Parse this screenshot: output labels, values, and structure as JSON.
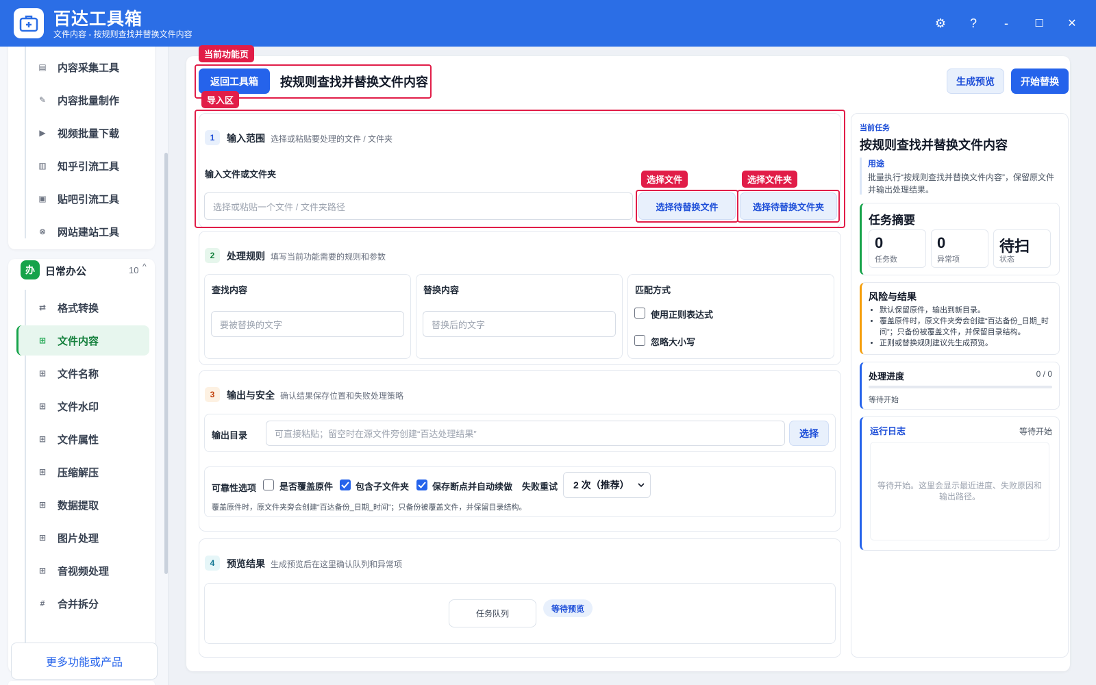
{
  "app": {
    "title": "百达工具箱",
    "subtitle": "文件内容 - 按规则查找并替换文件内容"
  },
  "window": {
    "settings": "⚙",
    "help": "?",
    "minimize": "-",
    "maximize": "☐",
    "close": "✕"
  },
  "sidebar": {
    "top_items": [
      {
        "label": "内容采集工具",
        "icon": "clipboard-icon",
        "glyph": "▤"
      },
      {
        "label": "内容批量制作",
        "icon": "pencil-icon",
        "glyph": "✎"
      },
      {
        "label": "视频批量下载",
        "icon": "video-icon",
        "glyph": "▶"
      },
      {
        "label": "知乎引流工具",
        "icon": "book-icon",
        "glyph": "▥"
      },
      {
        "label": "贴吧引流工具",
        "icon": "message-icon",
        "glyph": "▣"
      },
      {
        "label": "网站建站工具",
        "icon": "globe-icon",
        "glyph": "⊗"
      }
    ],
    "group": {
      "badge": "办",
      "title": "日常办公",
      "count": "10",
      "caret": "^"
    },
    "group_items": [
      {
        "label": "格式转换",
        "icon": "swap-icon",
        "glyph": "⇄"
      },
      {
        "label": "文件内容",
        "icon": "grid-icon",
        "glyph": "⊞"
      },
      {
        "label": "文件名称",
        "icon": "grid-icon",
        "glyph": "⊞"
      },
      {
        "label": "文件水印",
        "icon": "grid-icon",
        "glyph": "⊞"
      },
      {
        "label": "文件属性",
        "icon": "grid-icon",
        "glyph": "⊞"
      },
      {
        "label": "压缩解压",
        "icon": "grid-icon",
        "glyph": "⊞"
      },
      {
        "label": "数据提取",
        "icon": "grid-icon",
        "glyph": "⊞"
      },
      {
        "label": "图片处理",
        "icon": "grid-icon",
        "glyph": "⊞"
      },
      {
        "label": "音视频处理",
        "icon": "grid-icon",
        "glyph": "⊞"
      },
      {
        "label": "合并拆分",
        "icon": "hash-icon",
        "glyph": "#"
      }
    ],
    "more": "更多功能或产品"
  },
  "header": {
    "tag": "当前功能页",
    "back": "返回工具箱",
    "title": "按规则查找并替换文件内容",
    "preview": "生成预览",
    "start": "开始替换"
  },
  "import_tag": "导入区",
  "section1": {
    "num": "1",
    "title": "输入范围",
    "desc": "选择或粘贴要处理的文件 / 文件夹",
    "field_label": "输入文件或文件夹",
    "placeholder": "选择或粘贴一个文件 / 文件夹路径",
    "file_tag": "选择文件",
    "folder_tag": "选择文件夹",
    "file_btn": "选择待替换文件",
    "folder_btn": "选择待替换文件夹"
  },
  "section2": {
    "num": "2",
    "title": "处理规则",
    "desc": "填写当前功能需要的规则和参数",
    "find_label": "查找内容",
    "find_placeholder": "要被替换的文字",
    "replace_label": "替换内容",
    "replace_placeholder": "替换后的文字",
    "match_label": "匹配方式",
    "regex": "使用正则表达式",
    "ignore_case": "忽略大小写"
  },
  "section3": {
    "num": "3",
    "title": "输出与安全",
    "desc": "确认结果保存位置和失败处理策略",
    "out_label": "输出目录",
    "out_placeholder": "可直接粘贴；留空时在源文件旁创建“百达处理结果”",
    "choose": "选择",
    "rel_label": "可靠性选项",
    "overwrite": "是否覆盖原件",
    "subfolder": "包含子文件夹",
    "resume": "保存断点并自动续做",
    "retry_label": "失败重试",
    "retry_value": "2 次（推荐）",
    "note": "覆盖原件时，原文件夹旁会创建“百达备份_日期_时间”；只备份被覆盖文件，并保留目录结构。"
  },
  "section4": {
    "num": "4",
    "title": "预览结果",
    "desc": "生成预览后在这里确认队列和异常项",
    "queue": "任务队列",
    "status": "等待预览"
  },
  "right": {
    "task_label": "当前任务",
    "task_title": "按规则查找并替换文件内容",
    "purpose_label": "用途",
    "purpose_text": "批量执行“按规则查找并替换文件内容”，保留原文件并输出处理结果。",
    "summary_title": "任务摘要",
    "stats": [
      {
        "value": "0",
        "label": "任务数"
      },
      {
        "value": "0",
        "label": "异常项"
      },
      {
        "value": "待扫",
        "label": "状态"
      }
    ],
    "risk_title": "风险与结果",
    "risks": [
      "默认保留原件，输出到新目录。",
      "覆盖原件时，原文件夹旁会创建“百达备份_日期_时间”；只备份被覆盖文件，并保留目录结构。",
      "正则或替换规则建议先生成预览。"
    ],
    "progress_title": "处理进度",
    "progress_count": "0 / 0",
    "progress_fraction": 0,
    "progress_status": "等待开始",
    "log_title": "运行日志",
    "log_status": "等待开始",
    "log_text": "等待开始。这里会显示最近进度、失败原因和输出路径。"
  }
}
